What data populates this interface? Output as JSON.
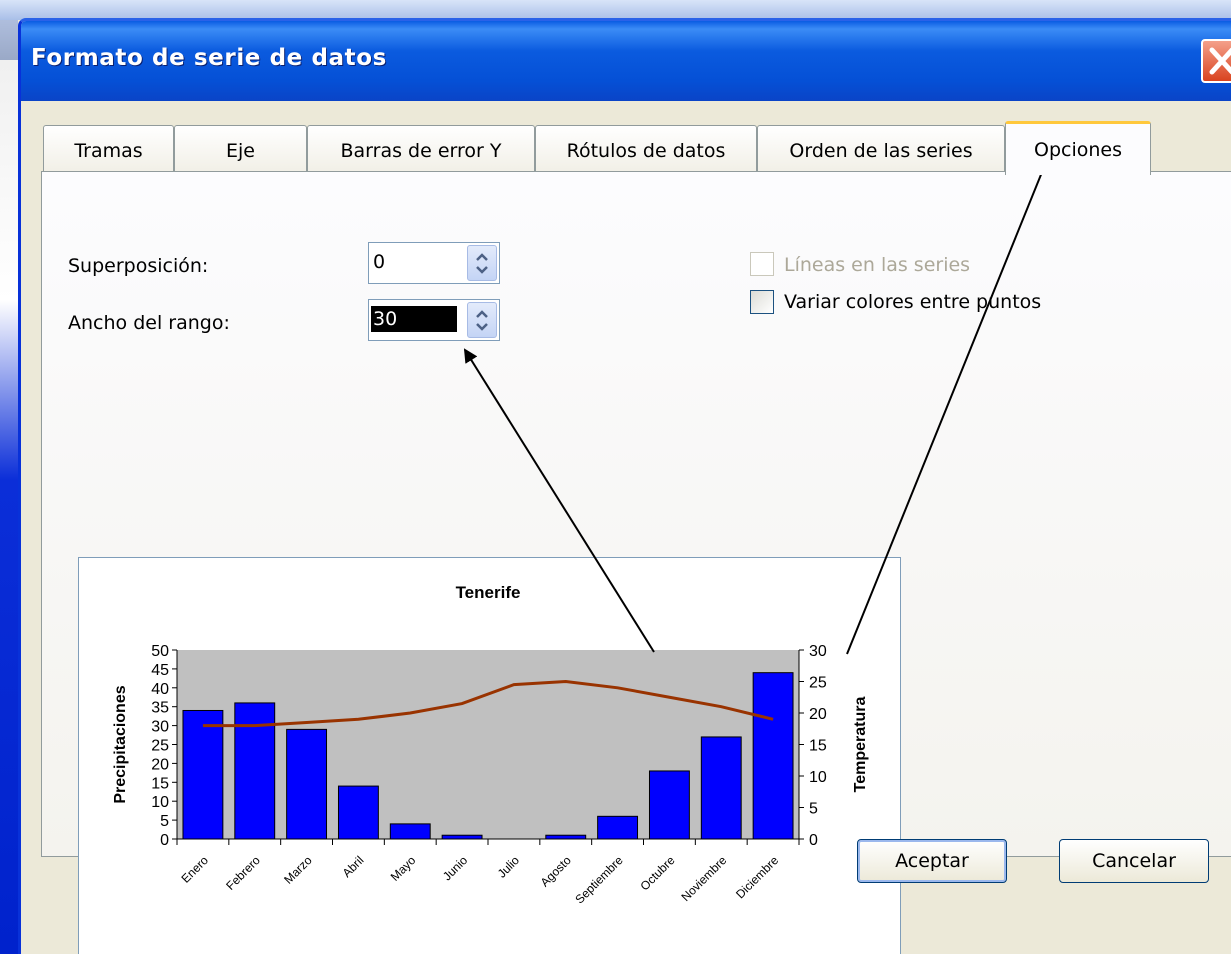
{
  "window": {
    "title": "Formato de serie de datos"
  },
  "tabs": [
    {
      "label": "Tramas",
      "active": false
    },
    {
      "label": "Eje",
      "active": false
    },
    {
      "label": "Barras de error Y",
      "active": false
    },
    {
      "label": "Rótulos de datos",
      "active": false
    },
    {
      "label": "Orden de las series",
      "active": false
    },
    {
      "label": "Opciones",
      "active": true
    }
  ],
  "options": {
    "overlap_label": "Superposición:",
    "overlap_value": "0",
    "gap_width_label": "Ancho del rango:",
    "gap_width_value": "30",
    "series_lines_label": "Líneas en las series",
    "series_lines_checked": false,
    "series_lines_enabled": false,
    "vary_colors_label": "Variar colores entre puntos",
    "vary_colors_checked": false
  },
  "buttons": {
    "ok": "Aceptar",
    "cancel": "Cancelar"
  },
  "colors": {
    "bar_fill": "#0000ff",
    "line": "#993300",
    "plot_area": "#c0c0c0",
    "active_tab_accent": "#ffc83c"
  },
  "chart_data": {
    "type": "bar",
    "title": "Tenerife",
    "categories": [
      "Enero",
      "Febrero",
      "Marzo",
      "Abril",
      "Mayo",
      "Junio",
      "Julio",
      "Agosto",
      "Septiembre",
      "Octubre",
      "Noviembre",
      "Diciembre"
    ],
    "series": [
      {
        "name": "Precipitaciones",
        "type": "bar",
        "axis": "left",
        "values": [
          34,
          36,
          29,
          14,
          4,
          1,
          0,
          1,
          6,
          18,
          27,
          44
        ]
      },
      {
        "name": "Temperatura",
        "type": "line",
        "axis": "right",
        "values": [
          18,
          18,
          18.5,
          19,
          20,
          21.5,
          24.5,
          25,
          24,
          22.5,
          21,
          19
        ]
      }
    ],
    "ylabel": "Precipitaciones",
    "y2label": "Temperatura",
    "ylim": [
      0,
      50
    ],
    "yticks": [
      0,
      5,
      10,
      15,
      20,
      25,
      30,
      35,
      40,
      45,
      50
    ],
    "y2lim": [
      0,
      30
    ],
    "y2ticks": [
      0,
      5,
      10,
      15,
      20,
      25,
      30
    ],
    "grid": false,
    "legend": "none"
  }
}
